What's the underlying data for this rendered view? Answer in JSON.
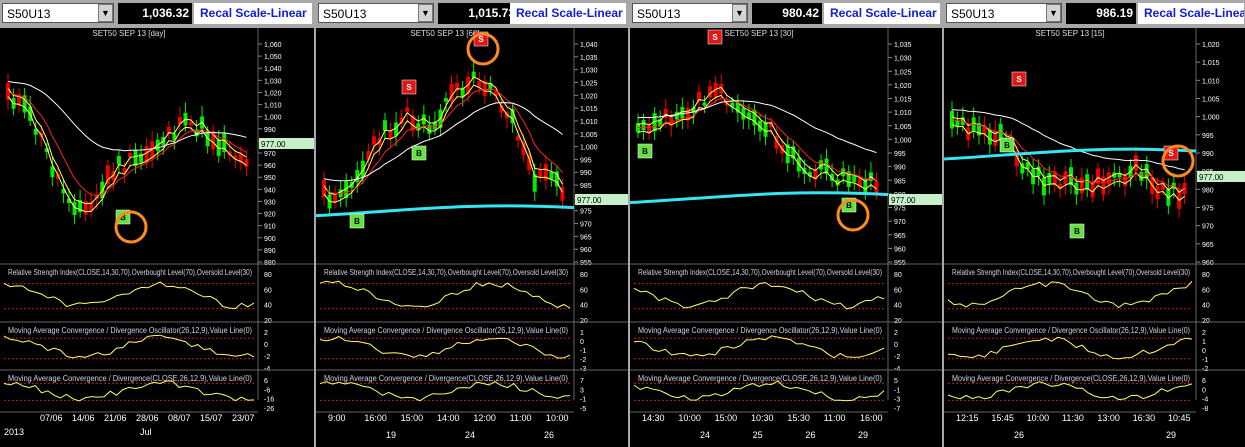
{
  "panels": [
    {
      "symbol": "S50U13",
      "price": "1,036.32",
      "recal_label": "Recal Scale-Linear",
      "chart_title": "SET50 SEP 13  [day]",
      "price_tag": "977.00",
      "y_ticks": [
        "1,060",
        "1,050",
        "1,040",
        "1,030",
        "1,020",
        "1,010",
        "1,000",
        "990",
        "980",
        "970",
        "960",
        "950",
        "940",
        "930",
        "920",
        "910",
        "900",
        "890",
        "880"
      ],
      "rsi_label": "Relative Strength Index(CLOSE,14,30,70),Overbought Level(70),Oversold Level(30)",
      "rsi_ticks": [
        "80",
        "60",
        "40",
        "20"
      ],
      "macd_label": "Moving Average Convergence / Divergence Oscillator(26,12,9),Value Line(0)",
      "macd_ticks": [
        "2",
        "0",
        "-2",
        "-4"
      ],
      "macd2_label": "Moving Average Convergence / Divergence(CLOSE,26,12,9),Value Line(0)",
      "macd2_ticks": [
        "6",
        "-6",
        "-16",
        "-26"
      ],
      "x_labels": [
        "2013",
        "07/06",
        "14/06",
        "21/06",
        "28/06",
        "08/07",
        "15/07",
        "23/07",
        "Jul"
      ],
      "signals": [
        "B"
      ]
    },
    {
      "symbol": "S50U13",
      "price": "1,015.73",
      "recal_label": "Recal Scale-Linear",
      "chart_title": "SET50 SEP 13  [60]",
      "price_tag": "977.00",
      "y_ticks": [
        "1,040",
        "1,035",
        "1,030",
        "1,025",
        "1,020",
        "1,015",
        "1,010",
        "1,005",
        "1,000",
        "995",
        "990",
        "985",
        "980",
        "975",
        "970",
        "965",
        "960",
        "955"
      ],
      "rsi_label": "Relative Strength Index(CLOSE,14,30,70),Overbought Level(70),Oversold Level(30)",
      "rsi_ticks": [
        "80",
        "60",
        "40",
        "20"
      ],
      "macd_label": "Moving Average Convergence / Divergence Oscillator(26,12,9),Value Line(0)",
      "macd_ticks": [
        "1",
        "0",
        "-1",
        "-2",
        "-3"
      ],
      "macd2_label": "Moving Average Convergence / Divergence(CLOSE,26,12,9),Value Line(0)",
      "macd2_ticks": [
        "7",
        "3",
        "-1",
        "-5"
      ],
      "x_labels": [
        "9:00",
        "16:00",
        "15:00",
        "14:00",
        "12:00",
        "11:00",
        "10:00",
        "19",
        "24",
        "26"
      ],
      "signals": [
        "S",
        "S",
        "B",
        "B"
      ]
    },
    {
      "symbol": "S50U13",
      "price": "980.42",
      "recal_label": "Recal Scale-Linear",
      "chart_title": "SET50 SEP 13  [30]",
      "price_tag": "977.00",
      "y_ticks": [
        "1,035",
        "1,030",
        "1,025",
        "1,020",
        "1,015",
        "1,010",
        "1,005",
        "1,000",
        "995",
        "990",
        "985",
        "980",
        "975",
        "970",
        "965",
        "960",
        "955"
      ],
      "rsi_label": "Relative Strength Index(CLOSE,14,30,70),Overbought Level(70),Oversold Level(30)",
      "rsi_ticks": [
        "80",
        "60",
        "40",
        "20"
      ],
      "macd_label": "Moving Average Convergence / Divergence Oscillator(26,12,9),Value Line(0)",
      "macd_ticks": [
        "2",
        "0",
        "-2",
        "-4"
      ],
      "macd2_label": "Moving Average Convergence / Divergence(CLOSE,26,12,9),Value Line(0)",
      "macd2_ticks": [
        "5",
        "-1",
        "-3",
        "-7"
      ],
      "x_labels": [
        "14:30",
        "10:00",
        "15:00",
        "10:30",
        "15:30",
        "11:00",
        "16:00",
        "24",
        "25",
        "26",
        "29"
      ],
      "signals": [
        "S",
        "B",
        "B"
      ]
    },
    {
      "symbol": "S50U13",
      "price": "986.19",
      "recal_label": "Recal Scale-Linear",
      "chart_title": "SET50 SEP 13  [15]",
      "price_tag": "977.00",
      "y_ticks": [
        "1,020",
        "1,015",
        "1,010",
        "1,005",
        "1,000",
        "995",
        "990",
        "985",
        "980",
        "975",
        "970",
        "965",
        "960"
      ],
      "rsi_label": "Relative Strength Index(CLOSE,14,30,70),Overbought Level(70),Oversold Level(30)",
      "rsi_ticks": [
        "80",
        "60",
        "40",
        "20"
      ],
      "macd_label": "Moving Average Convergence / Divergence Oscillator(26,12,9),Value Line(0)",
      "macd_ticks": [
        "2",
        "1",
        "0",
        "-1",
        "-2"
      ],
      "macd2_label": "Moving Average Convergence / Divergence(CLOSE,26,12,9),Value Line(0)",
      "macd2_ticks": [
        "6",
        "0",
        "-4",
        "-8"
      ],
      "x_labels": [
        "12:15",
        "15:45",
        "10:00",
        "11:30",
        "13:00",
        "16:30",
        "10:45",
        "26",
        "29"
      ],
      "signals": [
        "S",
        "S",
        "B",
        "B"
      ]
    }
  ],
  "colors": {
    "up_candle": "#00ee00",
    "down_candle": "#ee0000",
    "ma_fast": "#ffff66",
    "ma_mid": "#ff2020",
    "ma_slow": "#ffffff",
    "ma_long": "#33e6f2",
    "buy": "#66e040",
    "sell": "#e01818",
    "highlight": "#ff8a20"
  }
}
